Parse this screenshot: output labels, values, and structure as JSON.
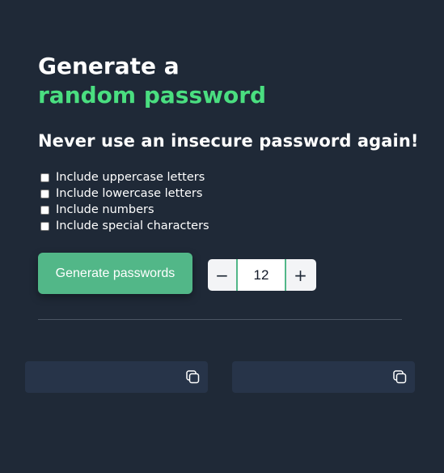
{
  "header": {
    "title_line1": "Generate a",
    "title_line2": "random password",
    "subtitle": "Never use an insecure password again!"
  },
  "options": [
    {
      "label": "Include uppercase letters",
      "checked": false
    },
    {
      "label": "Include lowercase letters",
      "checked": false
    },
    {
      "label": "Include numbers",
      "checked": false
    },
    {
      "label": "Include special characters",
      "checked": false
    }
  ],
  "actions": {
    "generate_label": "Generate passwords"
  },
  "length_stepper": {
    "decrement_label": "−",
    "value": "12",
    "increment_label": "+"
  },
  "outputs": [
    {
      "value": "",
      "icon": "copy-icon"
    },
    {
      "value": "",
      "icon": "copy-icon"
    }
  ],
  "colors": {
    "background": "#1f2937",
    "accent": "#4ade80",
    "button": "#52b788",
    "output_bg": "#273449"
  }
}
